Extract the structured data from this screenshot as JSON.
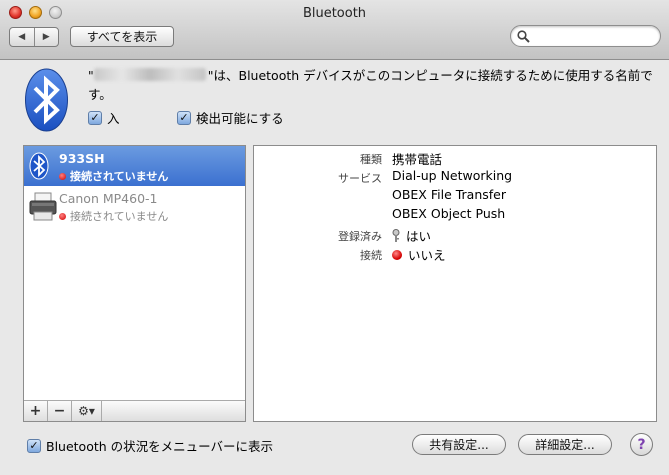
{
  "window": {
    "title": "Bluetooth"
  },
  "toolbar": {
    "back_glyph": "◀",
    "forward_glyph": "▶",
    "show_all_label": "すべてを表示",
    "search_placeholder": ""
  },
  "header": {
    "description": "\"は、Bluetooth デバイスがこのコンピュータに接続するために使用する名前です。",
    "description_prefix": "\"",
    "power_label": "入",
    "power_checked": true,
    "discoverable_label": "検出可能にする",
    "discoverable_checked": true
  },
  "devices": [
    {
      "name": "933SH",
      "status": "接続されていません",
      "icon": "bluetooth-icon",
      "selected": true
    },
    {
      "name": "Canon MP460-1",
      "status": "接続されていません",
      "icon": "printer-icon",
      "selected": false
    }
  ],
  "list_toolbar": {
    "add_glyph": "+",
    "remove_glyph": "−",
    "gear_glyph": "⚙▾"
  },
  "details": {
    "type_label": "種類",
    "type_value": "携帯電話",
    "services_label": "サービス",
    "services": [
      "Dial-up Networking",
      "OBEX File Transfer",
      "OBEX Object Push"
    ],
    "paired_label": "登録済み",
    "paired_value": "はい",
    "connected_label": "接続",
    "connected_value": "いいえ"
  },
  "footer": {
    "menu_label": "Bluetooth の状況をメニューバーに表示",
    "menu_checked": true,
    "sharing_button": "共有設定...",
    "advanced_button": "詳細設定...",
    "help_glyph": "?"
  },
  "colors": {
    "selection": "#3b70d0",
    "status_red": "#d00000",
    "help": "#7e43b0"
  }
}
